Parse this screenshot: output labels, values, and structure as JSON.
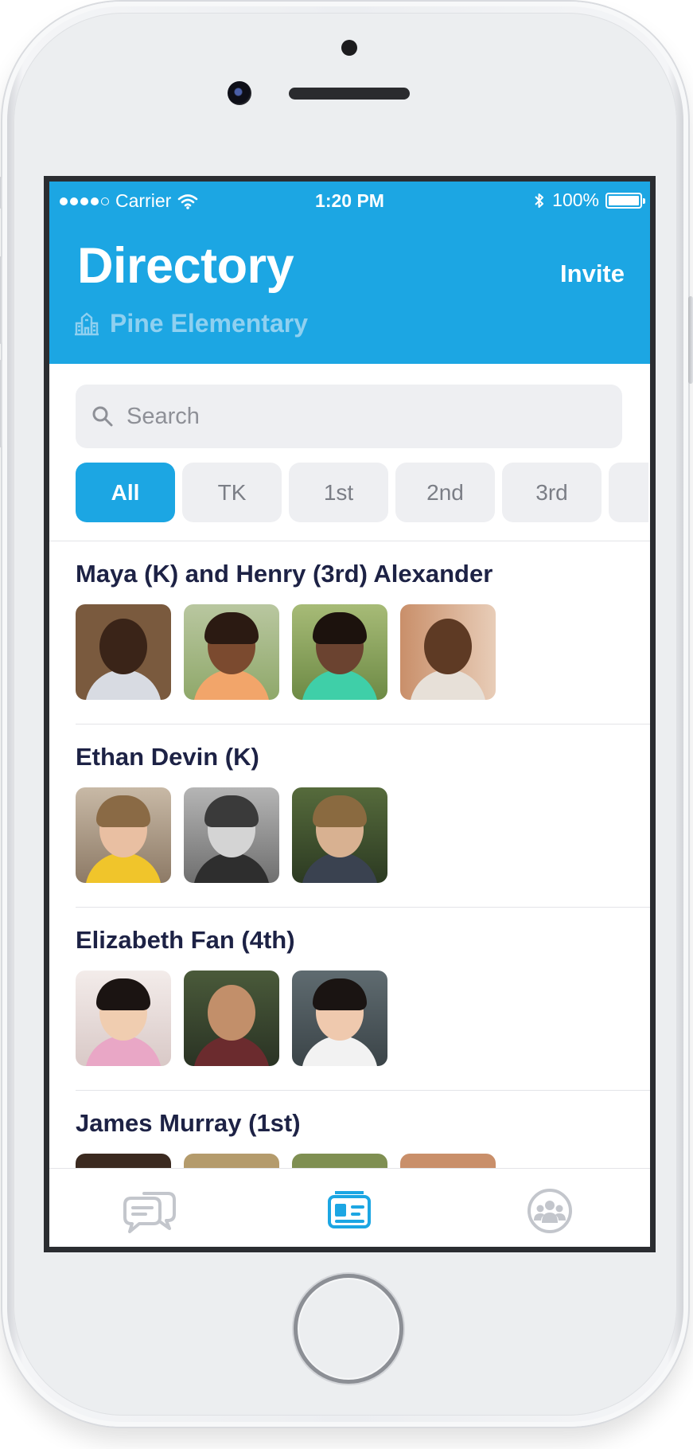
{
  "status_bar": {
    "carrier": "Carrier",
    "time": "1:20 PM",
    "battery": "100%"
  },
  "header": {
    "title": "Directory",
    "invite_label": "Invite",
    "school": "Pine Elementary"
  },
  "search": {
    "placeholder": "Search"
  },
  "filters": [
    "All",
    "TK",
    "1st",
    "2nd",
    "3rd"
  ],
  "families": [
    {
      "name": "Maya (K) and Henry (3rd) Alexander",
      "photo_count": 4
    },
    {
      "name": "Ethan Devin (K)",
      "photo_count": 3
    },
    {
      "name": "Elizabeth Fan (4th)",
      "photo_count": 3
    },
    {
      "name": "James Murray (1st)",
      "photo_count": 4
    }
  ],
  "tabs": [
    {
      "icon": "chat-icon",
      "active": false
    },
    {
      "icon": "directory-card-icon",
      "active": true
    },
    {
      "icon": "groups-icon",
      "active": false
    }
  ],
  "colors": {
    "accent": "#1ca6e3",
    "name_text": "#1d2245",
    "chip_bg": "#eeeff2",
    "inactive_icon": "#c3c6cc"
  }
}
